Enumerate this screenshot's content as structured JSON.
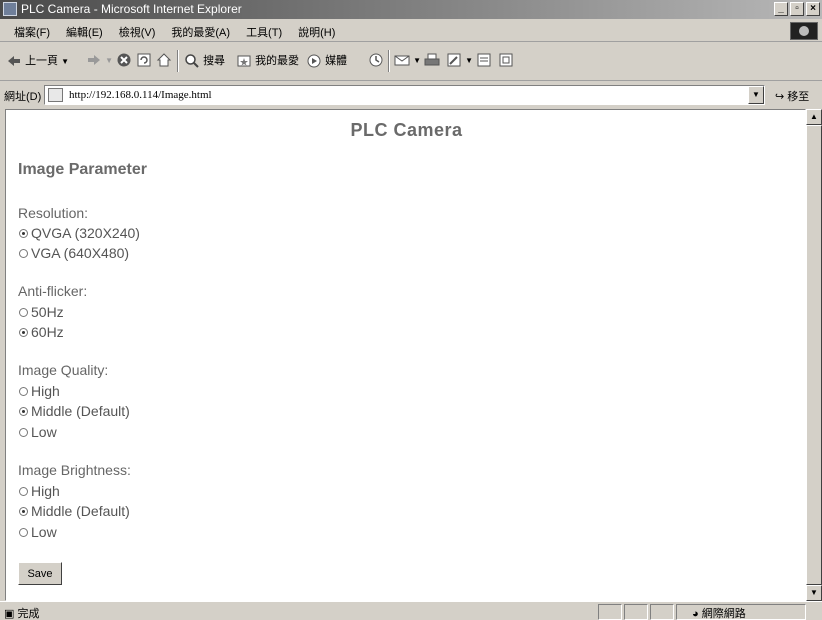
{
  "window": {
    "title": "PLC Camera - Microsoft Internet Explorer",
    "min": "_",
    "max": "▫",
    "close": "×"
  },
  "menu": [
    "檔案(F)",
    "編輯(E)",
    "檢視(V)",
    "我的最愛(A)",
    "工具(T)",
    "說明(H)"
  ],
  "toolbar": {
    "back": "上一頁",
    "search": "搜尋",
    "favorites": "我的最愛",
    "media": "媒體"
  },
  "address": {
    "label": "網址(D)",
    "url": "http://192.168.0.114/Image.html",
    "go": "移至"
  },
  "page": {
    "heading": "PLC Camera",
    "section_title": "Image Parameter",
    "groups": [
      {
        "label": "Resolution:",
        "options": [
          {
            "label": "QVGA (320X240)",
            "checked": true
          },
          {
            "label": "VGA (640X480)",
            "checked": false
          }
        ]
      },
      {
        "label": "Anti-flicker:",
        "options": [
          {
            "label": "50Hz",
            "checked": false
          },
          {
            "label": "60Hz",
            "checked": true
          }
        ]
      },
      {
        "label": "Image Quality:",
        "options": [
          {
            "label": "High",
            "checked": false
          },
          {
            "label": "Middle (Default)",
            "checked": true
          },
          {
            "label": "Low",
            "checked": false
          }
        ]
      },
      {
        "label": "Image Brightness:",
        "options": [
          {
            "label": "High",
            "checked": false
          },
          {
            "label": "Middle (Default)",
            "checked": true
          },
          {
            "label": "Low",
            "checked": false
          }
        ]
      }
    ],
    "save_label": "Save"
  },
  "status": {
    "text": "完成",
    "zone": "網際網路"
  }
}
